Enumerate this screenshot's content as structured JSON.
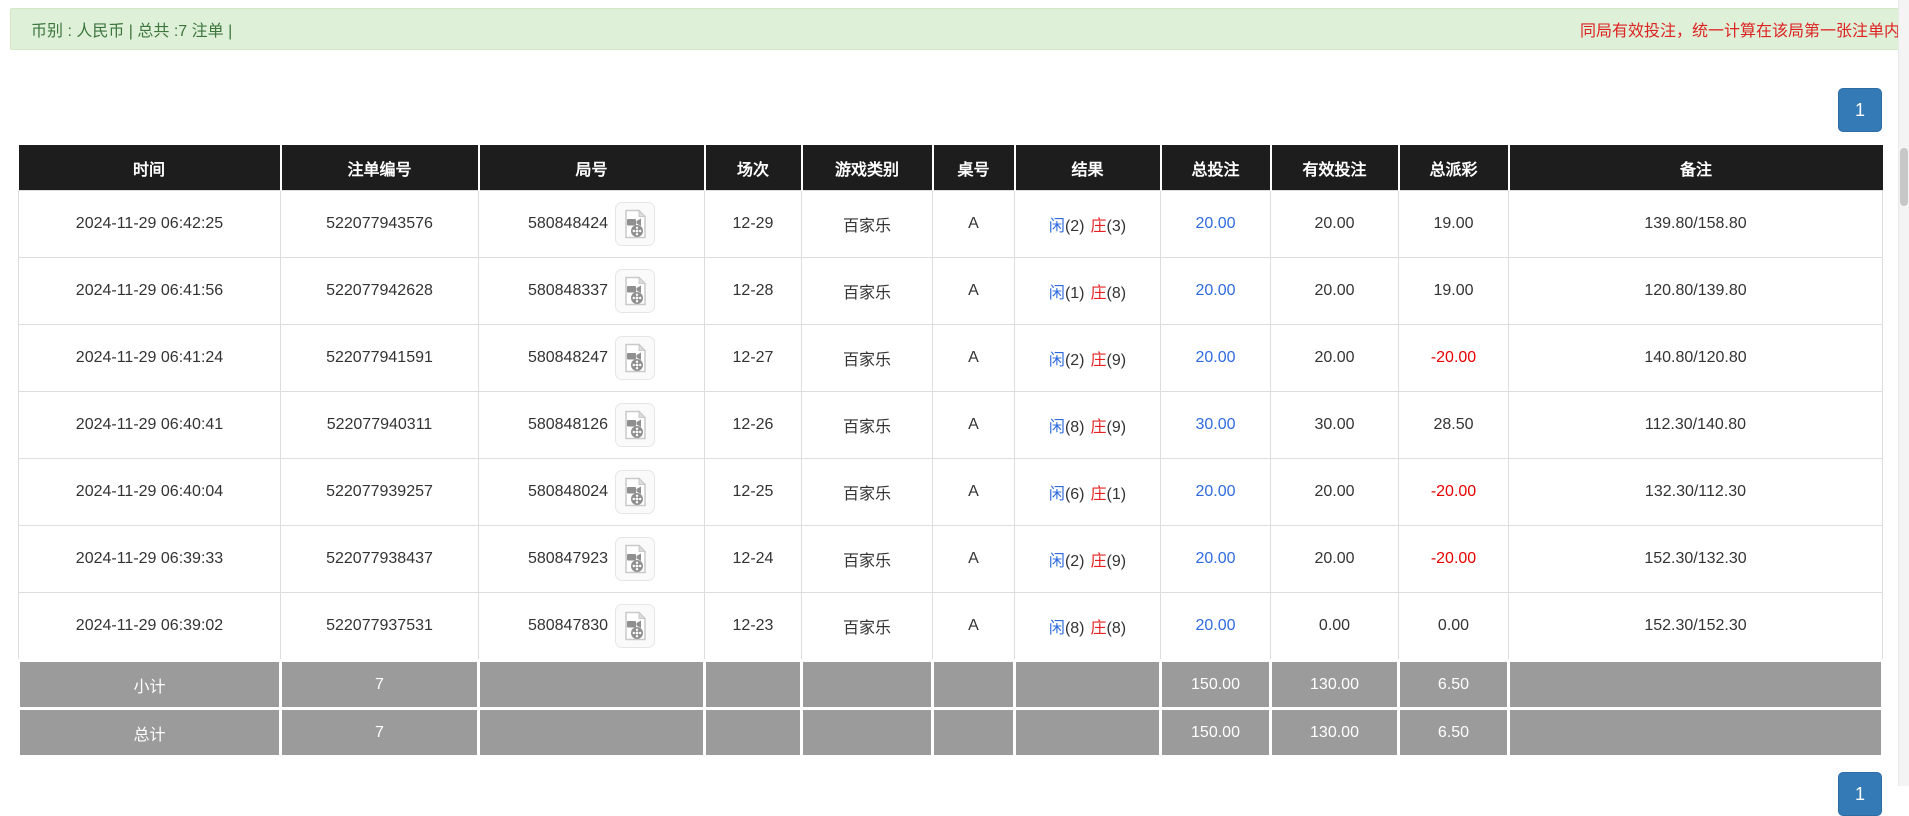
{
  "top_bar": {
    "summary_text": "币别 : 人民币 | 总共 :7 注单 |",
    "notice_text": "同局有效投注，统一计算在该局第一张注单内"
  },
  "pagination": {
    "page": "1"
  },
  "table": {
    "headers": [
      "时间",
      "注单编号",
      "局号",
      "场次",
      "游戏类别",
      "桌号",
      "结果",
      "总投注",
      "有效投注",
      "总派彩",
      "备注"
    ],
    "rows": [
      {
        "time": "2024-11-29 06:42:25",
        "bet_id": "522077943576",
        "round_id": "580848424",
        "session": "12-29",
        "game": "百家乐",
        "table_no": "A",
        "player_label": "闲",
        "player_value": "(2)",
        "banker_label": "庄",
        "banker_value": "(3)",
        "total_bet": "20.00",
        "valid_bet": "20.00",
        "payout": "19.00",
        "remark": "139.80/158.80"
      },
      {
        "time": "2024-11-29 06:41:56",
        "bet_id": "522077942628",
        "round_id": "580848337",
        "session": "12-28",
        "game": "百家乐",
        "table_no": "A",
        "player_label": "闲",
        "player_value": "(1)",
        "banker_label": "庄",
        "banker_value": "(8)",
        "total_bet": "20.00",
        "valid_bet": "20.00",
        "payout": "19.00",
        "remark": "120.80/139.80"
      },
      {
        "time": "2024-11-29 06:41:24",
        "bet_id": "522077941591",
        "round_id": "580848247",
        "session": "12-27",
        "game": "百家乐",
        "table_no": "A",
        "player_label": "闲",
        "player_value": "(2)",
        "banker_label": "庄",
        "banker_value": "(9)",
        "total_bet": "20.00",
        "valid_bet": "20.00",
        "payout": "-20.00",
        "remark": "140.80/120.80"
      },
      {
        "time": "2024-11-29 06:40:41",
        "bet_id": "522077940311",
        "round_id": "580848126",
        "session": "12-26",
        "game": "百家乐",
        "table_no": "A",
        "player_label": "闲",
        "player_value": "(8)",
        "banker_label": "庄",
        "banker_value": "(9)",
        "total_bet": "30.00",
        "valid_bet": "30.00",
        "payout": "28.50",
        "remark": "112.30/140.80"
      },
      {
        "time": "2024-11-29 06:40:04",
        "bet_id": "522077939257",
        "round_id": "580848024",
        "session": "12-25",
        "game": "百家乐",
        "table_no": "A",
        "player_label": "闲",
        "player_value": "(6)",
        "banker_label": "庄",
        "banker_value": "(1)",
        "total_bet": "20.00",
        "valid_bet": "20.00",
        "payout": "-20.00",
        "remark": "132.30/112.30"
      },
      {
        "time": "2024-11-29 06:39:33",
        "bet_id": "522077938437",
        "round_id": "580847923",
        "session": "12-24",
        "game": "百家乐",
        "table_no": "A",
        "player_label": "闲",
        "player_value": "(2)",
        "banker_label": "庄",
        "banker_value": "(9)",
        "total_bet": "20.00",
        "valid_bet": "20.00",
        "payout": "-20.00",
        "remark": "152.30/132.30"
      },
      {
        "time": "2024-11-29 06:39:02",
        "bet_id": "522077937531",
        "round_id": "580847830",
        "session": "12-23",
        "game": "百家乐",
        "table_no": "A",
        "player_label": "闲",
        "player_value": "(8)",
        "banker_label": "庄",
        "banker_value": "(8)",
        "total_bet": "20.00",
        "valid_bet": "0.00",
        "payout": "0.00",
        "remark": "152.30/152.30"
      }
    ],
    "subtotal": {
      "label": "小计",
      "count": "7",
      "total_bet": "150.00",
      "valid_bet": "130.00",
      "payout": "6.50"
    },
    "total": {
      "label": "总计",
      "count": "7",
      "total_bet": "150.00",
      "valid_bet": "130.00",
      "payout": "6.50"
    }
  },
  "icons": {
    "video_icon": "video-replay-icon"
  },
  "colors": {
    "alert_bg": "#dff0d8",
    "alert_text": "#3c763d",
    "notice_red": "#dd2222",
    "header_bg": "#1d1d1d",
    "summary_bg": "#9b9b9b",
    "link_blue": "#2f6bdf",
    "banker_red": "#e62222",
    "negative_red": "#e60000",
    "pagination_blue": "#337ab7"
  }
}
